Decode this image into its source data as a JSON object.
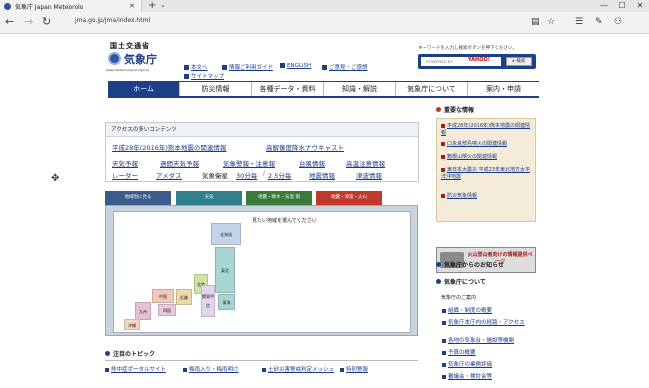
{
  "browser": {
    "tab_title": "気象庁 Japan Meteorolo",
    "tab_close": "✕",
    "new_tab": "+",
    "tab_list": "⌄",
    "url": "jma.go.jp/jma/index.html",
    "window": {
      "minimize": "—",
      "maximize": "☐",
      "close": "✕"
    },
    "toolbar": {
      "reader": "▤",
      "favorite": "☆",
      "hub": "☰",
      "notes": "✎",
      "share": "⚇"
    }
  },
  "header": {
    "ministry": "国土交通省",
    "logo_name": "気象庁",
    "logo_english": "Japan Meteorological Agency",
    "links": {
      "honbun": "本文へ",
      "guide": "情報ご利用ガイド",
      "english": "ENGLISH",
      "opinion": "ご意見・ご感想",
      "sitemap": "サイトマップ"
    },
    "search_hint": "キーワードを入力し検索ボタンを押下ください。",
    "search_placeholder": "POWERED BY",
    "search_provider": "YAHOO!",
    "search_button": "▸ 検索"
  },
  "nav": [
    "ホーム",
    "防災情報",
    "各種データ・資料",
    "知識・解説",
    "気象庁について",
    "案内・申請"
  ],
  "access": {
    "title": "アクセスの多いコンテンツ",
    "row1": [
      "平成28年(2016年)熊本地震の関連情報",
      "高解像度降水ナウキャスト"
    ],
    "row2": [
      "天気予報",
      "週間天気予報",
      "気象警報・注意報",
      "台風情報",
      "高温注意情報"
    ],
    "row3_plain": "気象衛星",
    "row3": [
      "レーダー",
      "アメダス",
      "30分毎",
      "2.5分毎",
      "地震情報",
      "津波情報"
    ]
  },
  "map_tabs": [
    "地域別に見る",
    "天気",
    "地震・降水・気温 雨",
    "地震・津波・火山"
  ],
  "map_hint": "見たい地域を選んでください",
  "regions": [
    "北海道",
    "東北",
    "北陸",
    "関東甲信",
    "東海",
    "近畿",
    "中国",
    "四国",
    "九州",
    "沖縄"
  ],
  "topics": {
    "title": "注目のトピック",
    "items": [
      "熱中症ポータルサイト",
      "梅雨入り・梅雨明け",
      "土砂災害警戒判定メッシュ",
      "特別警報"
    ]
  },
  "sidebar": {
    "important_title": "重要な情報",
    "important": [
      "平成28年(2016年)熊本地震の関連情報",
      "口永良部島噴火の関連情報",
      "箱根山噴火の関連情報",
      "東日本大震災 平成23年東北地方太平洋沖地震",
      "防災気象情報"
    ],
    "volcano_banner": "火山登山者向けの情報提供ページ",
    "news_title": "気象庁からのお知らせ",
    "about_title": "気象庁について",
    "about_sub": "気象庁のご案内",
    "about_items": [
      "組織・制度の概要",
      "気象庁本庁内の経路・アクセス",
      "各地の気象台・施設等機関",
      "予算の概要",
      "気象庁の業務評価",
      "審議会・検討会等"
    ]
  },
  "colors": {
    "brand": "#1d3f87",
    "tab_blue": "#3b5b8c",
    "tab_teal": "#2f7f8c",
    "tab_green": "#3a7a3a",
    "tab_red": "#c0392b"
  }
}
